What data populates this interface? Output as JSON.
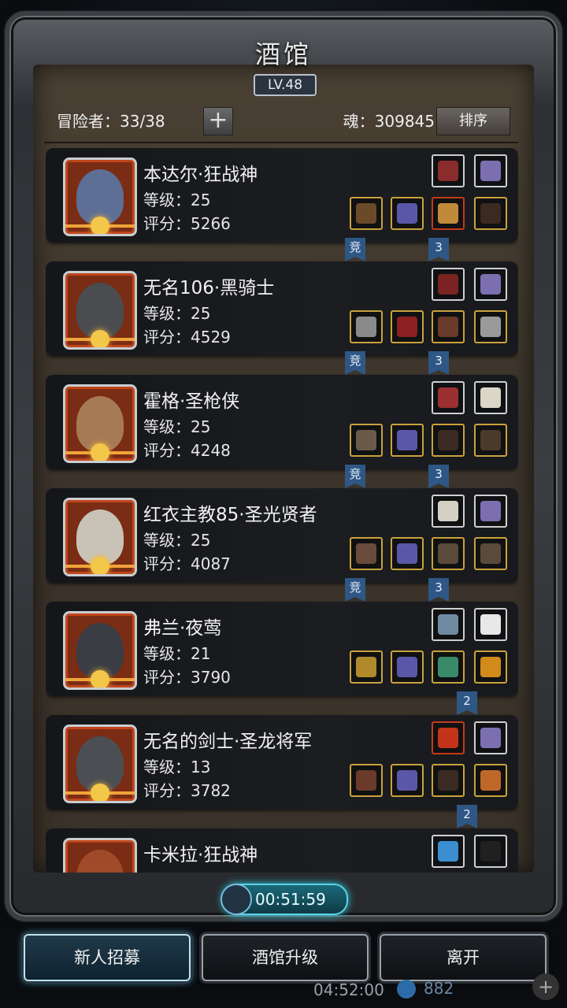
{
  "window": {
    "title": "酒馆",
    "level": "LV.48"
  },
  "header": {
    "adventurers": "冒险者：33/38",
    "add_label": "+",
    "soul": "魂：309845",
    "sort_label": "排序"
  },
  "heroes": [
    {
      "name": "本达尔·狂战神",
      "level": "等级：25",
      "score": "评分：5266",
      "tags": [
        "竞",
        "3"
      ],
      "face": "#5d6f95"
    },
    {
      "name": "无名106·黑骑士",
      "level": "等级：25",
      "score": "评分：4529",
      "tags": [
        "竞",
        "3"
      ],
      "face": "#4a4c50"
    },
    {
      "name": "霍格·圣枪侠",
      "level": "等级：25",
      "score": "评分：4248",
      "tags": [
        "竞",
        "3"
      ],
      "face": "#a67a55"
    },
    {
      "name": "红衣主教85·圣光贤者",
      "level": "等级：25",
      "score": "评分：4087",
      "tags": [
        "竞",
        "3"
      ],
      "face": "#c9c2b6"
    },
    {
      "name": "弗兰·夜莺",
      "level": "等级：21",
      "score": "评分：3790",
      "tags": [
        "2"
      ],
      "face": "#3a3d44"
    },
    {
      "name": "无名的剑士·圣龙将军",
      "level": "等级：13",
      "score": "评分：3782",
      "tags": [
        "2"
      ],
      "face": "#4b4e53"
    },
    {
      "name": "卡米拉·狂战神",
      "level": "",
      "score": "",
      "tags": [],
      "face": "#a04a2a"
    }
  ],
  "timer": "00:51:59",
  "buttons": {
    "recruit": "新人招募",
    "upgrade": "酒馆升级",
    "leave": "离开"
  },
  "under": {
    "time": "04:52:00",
    "gems": "882",
    "plus": "+"
  },
  "colors": {
    "tag": "#2e5786",
    "timer_glow": "#2bc8e0",
    "gold": "#c9a23c"
  }
}
